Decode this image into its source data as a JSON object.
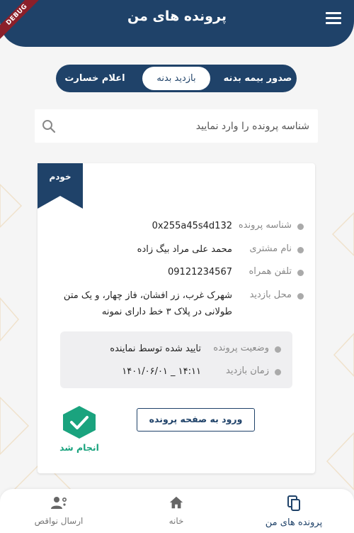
{
  "header": {
    "title": "پرونده های من",
    "debug_badge": "DEBUG"
  },
  "tabs": [
    {
      "label": "صدور بیمه بدنه",
      "active": false
    },
    {
      "label": "بازدید بدنه",
      "active": true
    },
    {
      "label": "اعلام خسارت",
      "active": false
    }
  ],
  "search": {
    "placeholder": "شناسه پرونده را وارد نمایید"
  },
  "card": {
    "owner_tag": "خودم",
    "fields": [
      {
        "label": "شناسه پرونده",
        "value": "0x255a45s4d132"
      },
      {
        "label": "نام مشتری",
        "value": "محمد علی مراد بیگ زاده"
      },
      {
        "label": "تلفن همراه",
        "value": "09121234567"
      },
      {
        "label": "محل بازدید",
        "value": "شهرک غرب، زر افشان، فاز چهار، و یک متن طولانی در پلاک ۳ خط دارای نمونه"
      }
    ],
    "status": [
      {
        "label": "وضعیت پرونده",
        "value": "تایید شده توسط نماینده"
      },
      {
        "label": "زمان بازدید",
        "value": "۱۴۰۱/۰۶/۰۱ _ ۱۴:۱۱"
      }
    ],
    "enter_button": "ورود به صفحه پرونده",
    "done_label": "انجام شد"
  },
  "bottom_nav": [
    {
      "label": "پرونده های من",
      "icon": "files-icon",
      "active": true
    },
    {
      "label": "خانه",
      "icon": "home-icon",
      "active": false
    },
    {
      "label": "ارسال نواقص",
      "icon": "user-settings-icon",
      "active": false
    }
  ],
  "colors": {
    "primary": "#1f4269",
    "success": "#1aa37e",
    "background": "#f5f5f5"
  }
}
